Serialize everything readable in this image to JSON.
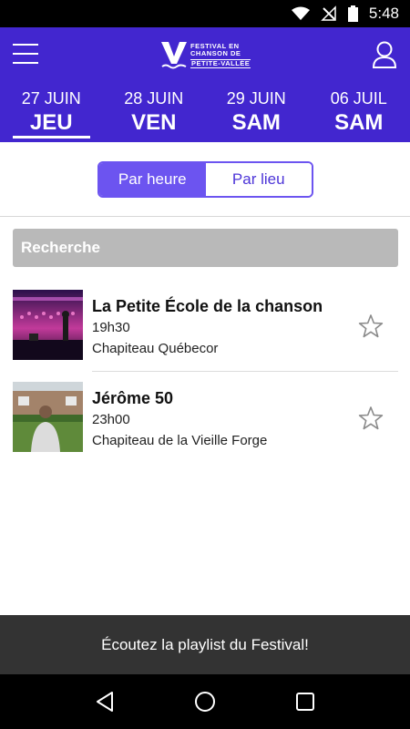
{
  "status": {
    "time": "5:48"
  },
  "header": {
    "logo_lines": [
      "FESTIVAL EN",
      "CHANSON DE",
      "PETITE-VALLÉE"
    ],
    "brand_color": "#4226cf",
    "icons": {
      "menu": "hamburger-icon",
      "profile": "user-icon"
    }
  },
  "date_tabs": [
    {
      "date": "27 JUIN",
      "day": "JEU",
      "selected": true
    },
    {
      "date": "28 JUIN",
      "day": "VEN",
      "selected": false
    },
    {
      "date": "29 JUIN",
      "day": "SAM",
      "selected": false
    },
    {
      "date": "06 JUIL",
      "day": "SAM",
      "selected": false
    }
  ],
  "view_toggle": {
    "by_hour": "Par heure",
    "by_place": "Par lieu",
    "active": "by_hour"
  },
  "search": {
    "placeholder": "Recherche"
  },
  "events": [
    {
      "title": "La Petite École de la chanson",
      "time": "19h30",
      "place": "Chapiteau Québecor",
      "favorite": false
    },
    {
      "title": "Jérôme 50",
      "time": "23h00",
      "place": "Chapiteau de la Vieille Forge",
      "favorite": false
    }
  ],
  "footer": {
    "playlist_label": "Écoutez la playlist du Festival!"
  },
  "navigation": {
    "icons": [
      "back-icon",
      "home-icon",
      "recents-icon"
    ]
  }
}
